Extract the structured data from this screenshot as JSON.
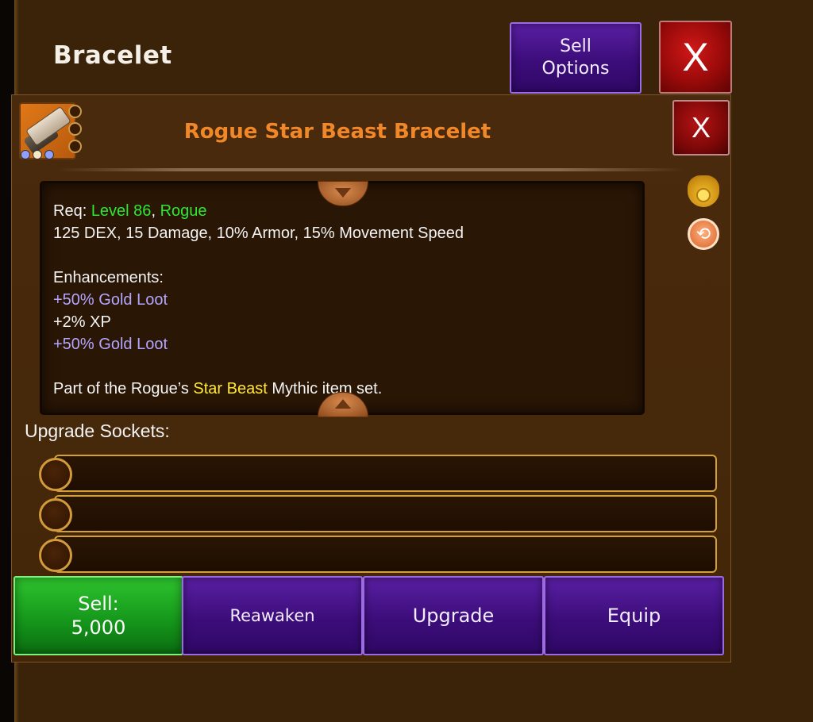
{
  "screen": {
    "title": "Bracelet"
  },
  "header": {
    "sell_options_line1": "Sell",
    "sell_options_line2": "Options",
    "close_label": "X"
  },
  "item": {
    "name": "Rogue Star Beast Bracelet",
    "close_label": "X",
    "gem_colors": [
      "#8fa0ff",
      "#f4e8c8",
      "#8fa0ff"
    ],
    "name_color": "#f0882a"
  },
  "description": {
    "req_prefix": "Req: ",
    "req_level": "Level 86",
    "req_sep": ", ",
    "req_class": "Rogue",
    "stats": "125 DEX, 15 Damage, 10% Armor, 15% Movement Speed",
    "enh_heading": "Enhancements:",
    "enhancements": [
      {
        "text": "+50% Gold Loot",
        "color": "lav"
      },
      {
        "text": "+2% XP",
        "color": "white"
      },
      {
        "text": "+50% Gold Loot",
        "color": "lav"
      }
    ],
    "set_prefix": "Part of the Rogue’s ",
    "set_name": "Star Beast",
    "set_suffix": " Mythic item set."
  },
  "sockets": {
    "label": "Upgrade Sockets:",
    "count": 3
  },
  "actions": {
    "sell_line1": "Sell:",
    "sell_line2": "5,000",
    "reawaken": "Reawaken",
    "upgrade": "Upgrade",
    "equip": "Equip"
  },
  "icons": {
    "gold_bag": "gold-bag-icon",
    "swap": "swap-icon"
  }
}
